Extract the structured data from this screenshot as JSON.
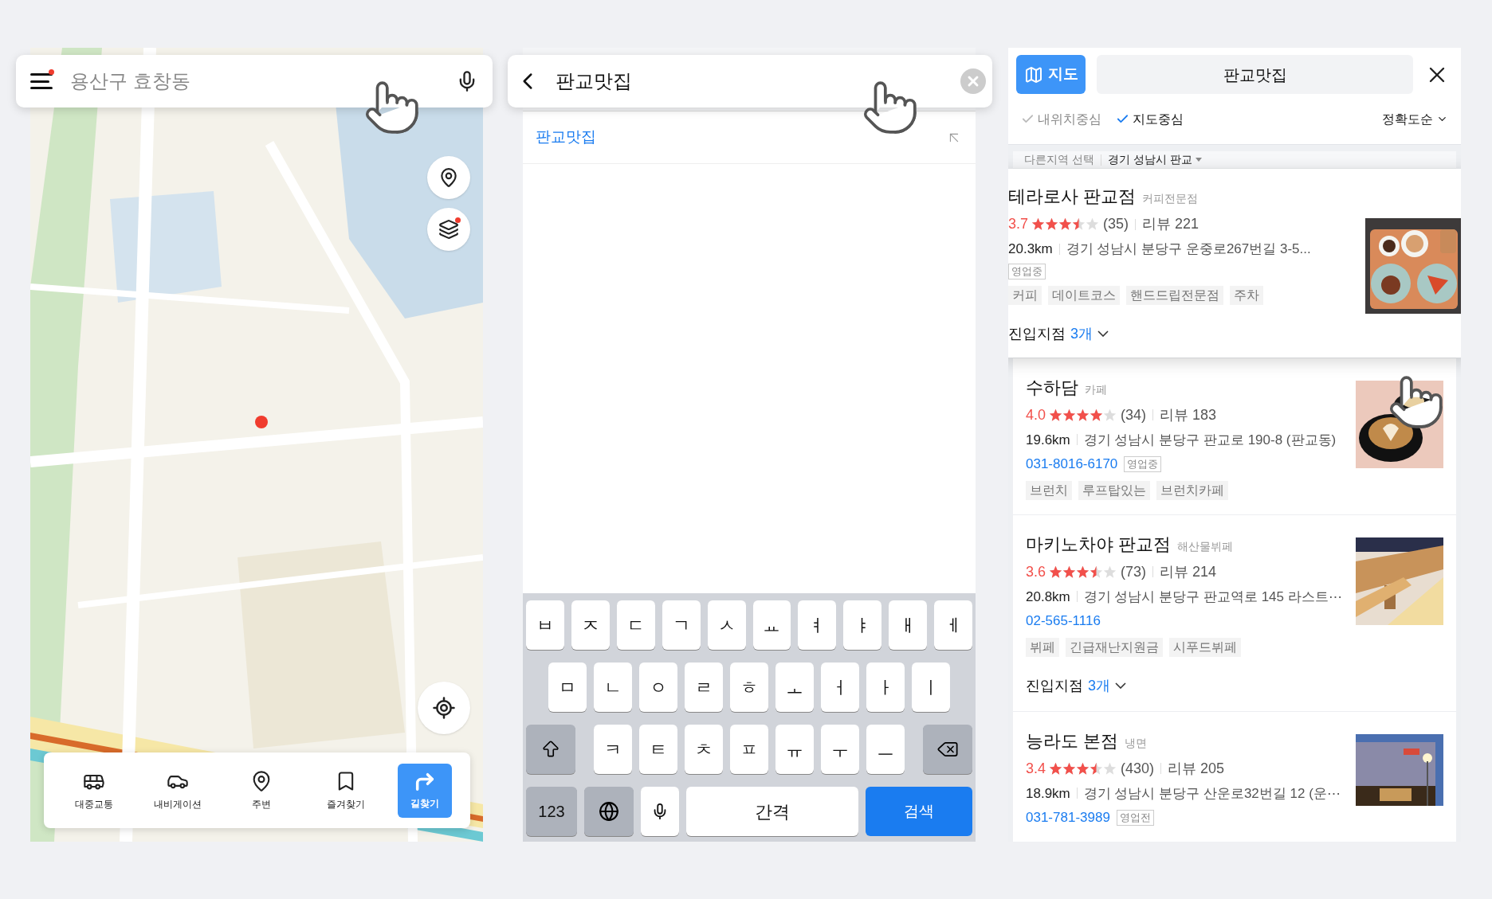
{
  "map_screen": {
    "search": {
      "placeholder": "용산구 효창동",
      "notice": true
    },
    "layers_notice": true,
    "nav": [
      {
        "label": "대중교통",
        "kind": "bus",
        "selected": false
      },
      {
        "label": "내비게이션",
        "kind": "car",
        "selected": false
      },
      {
        "label": "주변",
        "kind": "pin",
        "selected": false
      },
      {
        "label": "즐겨찾기",
        "kind": "bookmark",
        "selected": false
      },
      {
        "label": "길찾기",
        "kind": "directions",
        "selected": true
      }
    ]
  },
  "search_screen": {
    "query": "판교맛집",
    "suggestions": [
      "판교맛집"
    ],
    "keyboard": {
      "rows": [
        [
          "ㅂ",
          "ㅈ",
          "ㄷ",
          "ㄱ",
          "ㅅ",
          "ㅛ",
          "ㅕ",
          "ㅑ",
          "ㅐ",
          "ㅔ"
        ],
        [
          "ㅁ",
          "ㄴ",
          "ㅇ",
          "ㄹ",
          "ㅎ",
          "ㅗ",
          "ㅓ",
          "ㅏ",
          "ㅣ"
        ],
        [
          "ㅋ",
          "ㅌ",
          "ㅊ",
          "ㅍ",
          "ㅠ",
          "ㅜ",
          "ㅡ"
        ]
      ],
      "numbers": "123",
      "space": "간격",
      "search": "검색"
    }
  },
  "results_screen": {
    "map_button": "지도",
    "query": "판교맛집",
    "filters": [
      {
        "label": "내위치중심",
        "selected": false
      },
      {
        "label": "지도중심",
        "selected": true
      }
    ],
    "sort": "정확도순",
    "region_label": "다른지역 선택",
    "region": "경기 성남시 판교",
    "places": [
      {
        "name": "테라로사 판교점",
        "category": "커피전문점",
        "rating": "3.7",
        "stars": 3.5,
        "count": "(35)",
        "reviews": "리뷰 221",
        "distance": "20.3km",
        "address": "경기 성남시 분당구 운중로267번길 3-5...",
        "status": "영업중",
        "tags": [
          "커피",
          "데이트코스",
          "핸드드립전문점",
          "주차"
        ],
        "branches": "진입지점",
        "branch_count": "3개",
        "highlighted": true,
        "kind": "picture"
      },
      {
        "name": "수하담",
        "category": "카페",
        "rating": "4.0",
        "stars": 4,
        "count": "(34)",
        "reviews": "리뷰 183",
        "distance": "19.6km",
        "address": "경기 성남시 분당구 판교로 190-8 (판교동)",
        "phone": "031-8016-6170",
        "status": "영업중",
        "tags": [
          "브런치",
          "루프탑있는",
          "브런치카페"
        ],
        "highlighted": false,
        "kind": "picture"
      },
      {
        "name": "마키노차야 판교점",
        "category": "해산물뷔페",
        "rating": "3.6",
        "stars": 3.5,
        "count": "(73)",
        "reviews": "리뷰 214",
        "distance": "20.8km",
        "address": "경기 성남시 분당구 판교역로 145 라스트⋯",
        "phone": "02-565-1116",
        "tags": [
          "뷔페",
          "긴급재난지원금",
          "시푸드뷔페"
        ],
        "branches": "진입지점",
        "branch_count": "3개",
        "highlighted": false,
        "kind": "picture"
      },
      {
        "name": "능라도 본점",
        "category": "냉면",
        "rating": "3.4",
        "stars": 3.5,
        "count": "(430)",
        "reviews": "리뷰 205",
        "distance": "18.9km",
        "address": "경기 성남시 분당구 산운로32번길 12 (운⋯",
        "phone": "031-781-3989",
        "status": "영업전",
        "highlighted": false,
        "kind": "picture"
      }
    ]
  }
}
